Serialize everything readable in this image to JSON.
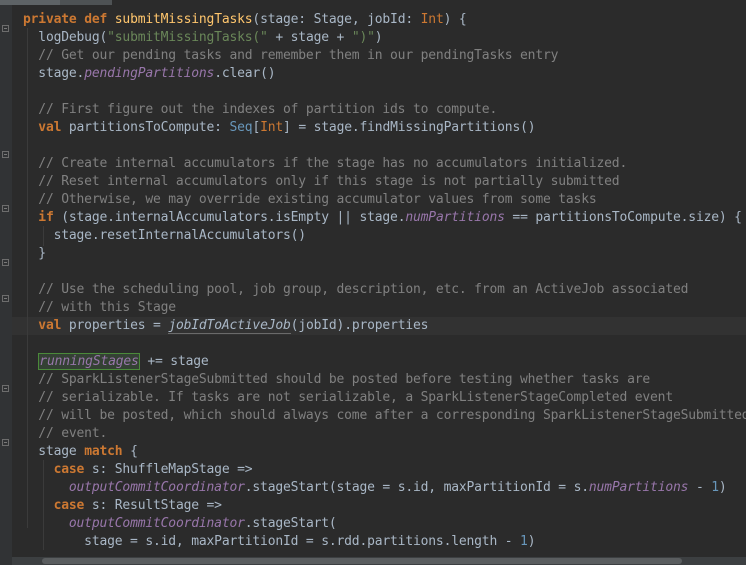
{
  "code": {
    "lines": [
      [
        {
          "t": "private ",
          "c": "kw"
        },
        {
          "t": "def ",
          "c": "kw"
        },
        {
          "t": "submitMissingTasks",
          "c": "fn"
        },
        {
          "t": "(stage: Stage, jobId: ",
          "c": ""
        },
        {
          "t": "Int",
          "c": "typ"
        },
        {
          "t": ") {",
          "c": ""
        }
      ],
      [
        {
          "t": "  logDebug(",
          "c": ""
        },
        {
          "t": "\"submitMissingTasks(\"",
          "c": "str"
        },
        {
          "t": " + stage + ",
          "c": ""
        },
        {
          "t": "\")\"",
          "c": "str"
        },
        {
          "t": ")",
          "c": ""
        }
      ],
      [
        {
          "t": "  // Get our pending tasks and remember them in our pendingTasks entry",
          "c": "cmt"
        }
      ],
      [
        {
          "t": "  stage.",
          "c": ""
        },
        {
          "t": "pendingPartitions",
          "c": "fld"
        },
        {
          "t": ".clear()",
          "c": ""
        }
      ],
      [],
      [
        {
          "t": "  // First figure out the indexes of partition ids to compute.",
          "c": "cmt"
        }
      ],
      [
        {
          "t": "  ",
          "c": ""
        },
        {
          "t": "val ",
          "c": "kw"
        },
        {
          "t": "partitionsToCompute: ",
          "c": ""
        },
        {
          "t": "Seq",
          "c": "seqt"
        },
        {
          "t": "[",
          "c": ""
        },
        {
          "t": "Int",
          "c": "typ"
        },
        {
          "t": "] = stage.findMissingPartitions()",
          "c": ""
        }
      ],
      [],
      [
        {
          "t": "  // Create internal accumulators if the stage has no accumulators initialized.",
          "c": "cmt"
        }
      ],
      [
        {
          "t": "  // Reset internal accumulators only if this stage is not partially submitted",
          "c": "cmt"
        }
      ],
      [
        {
          "t": "  // Otherwise, we may override existing accumulator values from some tasks",
          "c": "cmt"
        }
      ],
      [
        {
          "t": "  ",
          "c": ""
        },
        {
          "t": "if ",
          "c": "kw"
        },
        {
          "t": "(stage.internalAccumulators.isEmpty || stage.",
          "c": ""
        },
        {
          "t": "numPartitions",
          "c": "fld"
        },
        {
          "t": " == partitionsToCompute.size) {",
          "c": ""
        }
      ],
      [
        {
          "t": "    stage.resetInternalAccumulators()",
          "c": ""
        }
      ],
      [
        {
          "t": "  }",
          "c": ""
        }
      ],
      [],
      [
        {
          "t": "  // Use the scheduling pool, job group, description, etc. from an ActiveJob associated",
          "c": "cmt"
        }
      ],
      [
        {
          "t": "  // with this Stage",
          "c": "cmt"
        }
      ],
      [
        {
          "t": "  ",
          "c": ""
        },
        {
          "t": "val ",
          "c": "kw"
        },
        {
          "t": "properties = ",
          "c": ""
        },
        {
          "t": "jobIdToActiveJob",
          "c": "hl"
        },
        {
          "t": "(jobId).properties",
          "c": ""
        }
      ],
      [],
      [
        {
          "t": "  ",
          "c": ""
        },
        {
          "t": "runningStages",
          "c": "hlg"
        },
        {
          "t": " += stage",
          "c": ""
        }
      ],
      [
        {
          "t": "  // SparkListenerStageSubmitted should be posted before testing whether tasks are",
          "c": "cmt"
        }
      ],
      [
        {
          "t": "  // serializable. If tasks are not serializable, a SparkListenerStageCompleted event",
          "c": "cmt"
        }
      ],
      [
        {
          "t": "  // will be posted, which should always come after a corresponding SparkListenerStageSubmitted",
          "c": "cmt"
        }
      ],
      [
        {
          "t": "  // event.",
          "c": "cmt"
        }
      ],
      [
        {
          "t": "  stage ",
          "c": ""
        },
        {
          "t": "match ",
          "c": "kw"
        },
        {
          "t": "{",
          "c": ""
        }
      ],
      [
        {
          "t": "    ",
          "c": ""
        },
        {
          "t": "case ",
          "c": "kw"
        },
        {
          "t": "s: ShuffleMapStage =>",
          "c": ""
        }
      ],
      [
        {
          "t": "      ",
          "c": ""
        },
        {
          "t": "outputCommitCoordinator",
          "c": "fld"
        },
        {
          "t": ".stageStart(stage = s.id, maxPartitionId = s.",
          "c": ""
        },
        {
          "t": "numPartitions",
          "c": "fld"
        },
        {
          "t": " - ",
          "c": ""
        },
        {
          "t": "1",
          "c": "num"
        },
        {
          "t": ")",
          "c": ""
        }
      ],
      [
        {
          "t": "    ",
          "c": ""
        },
        {
          "t": "case ",
          "c": "kw"
        },
        {
          "t": "s: ResultStage =>",
          "c": ""
        }
      ],
      [
        {
          "t": "      ",
          "c": ""
        },
        {
          "t": "outputCommitCoordinator",
          "c": "fld"
        },
        {
          "t": ".stageStart(",
          "c": ""
        }
      ],
      [
        {
          "t": "        stage = s.id, maxPartitionId = s.rdd.partitions.length - ",
          "c": ""
        },
        {
          "t": "1",
          "c": "num"
        },
        {
          "t": ")",
          "c": ""
        }
      ]
    ]
  }
}
